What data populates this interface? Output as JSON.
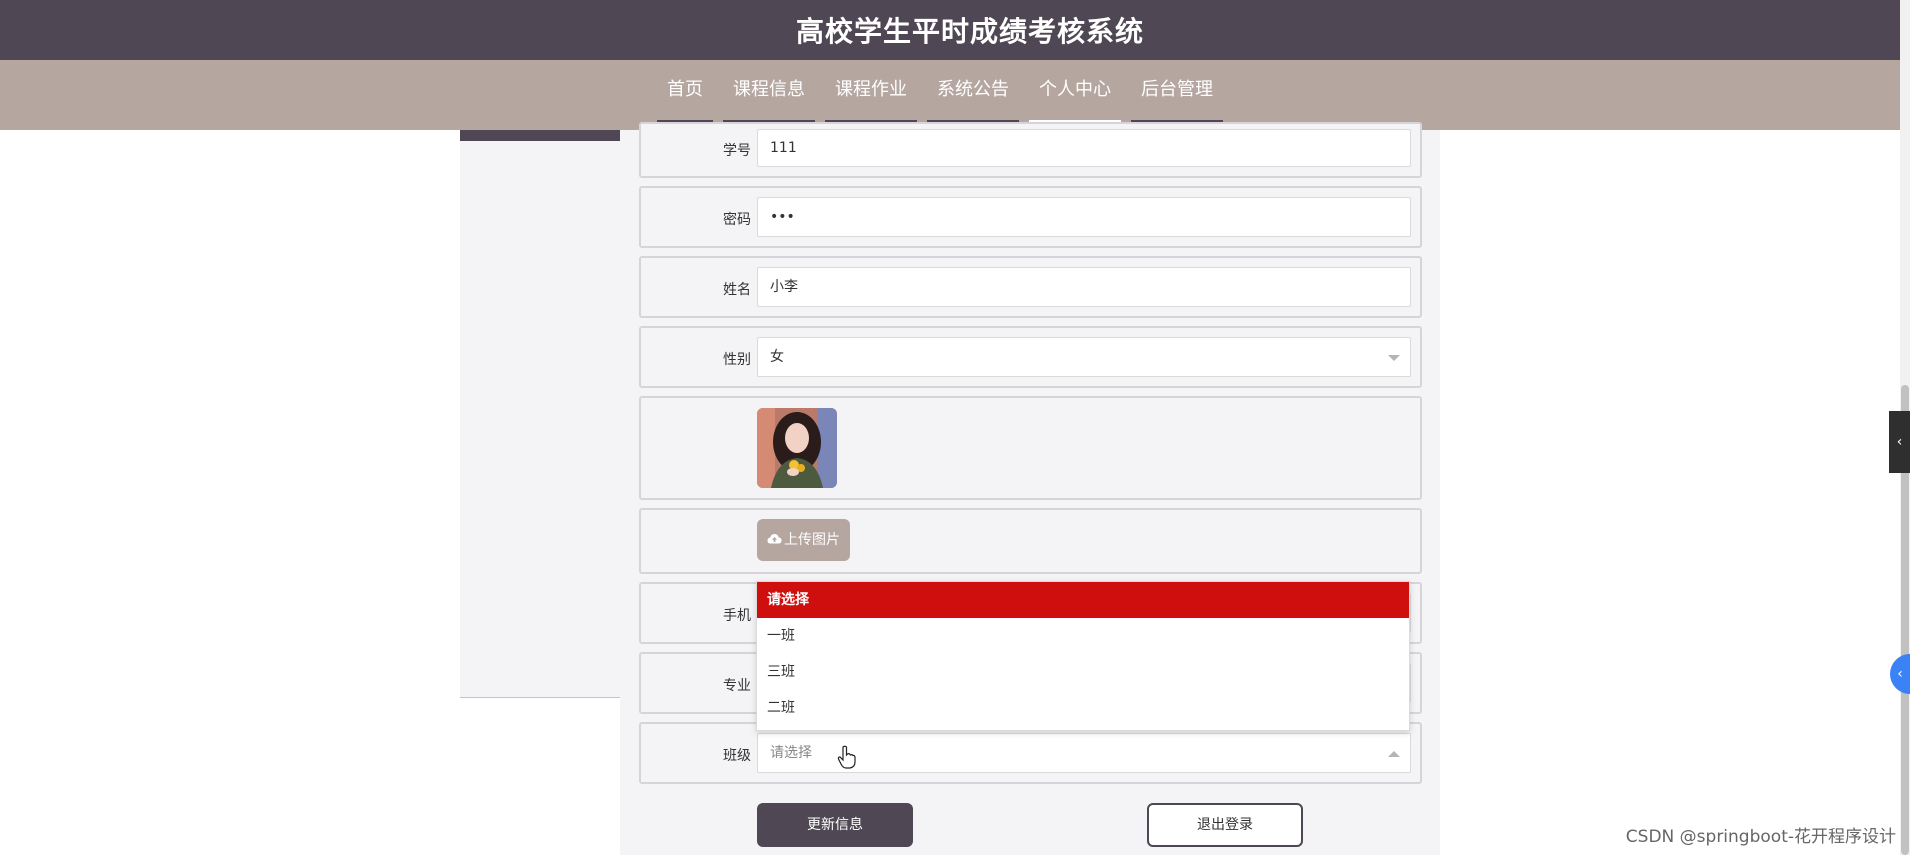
{
  "header": {
    "title": "高校学生平时成绩考核系统"
  },
  "nav": {
    "items": [
      {
        "label": "首页",
        "active": false
      },
      {
        "label": "课程信息",
        "active": false
      },
      {
        "label": "课程作业",
        "active": false
      },
      {
        "label": "系统公告",
        "active": false
      },
      {
        "label": "个人中心",
        "active": true
      },
      {
        "label": "后台管理",
        "active": false
      }
    ]
  },
  "form": {
    "student_id": {
      "label": "学号",
      "value": "111"
    },
    "password": {
      "label": "密码",
      "value": "•••"
    },
    "name": {
      "label": "姓名",
      "value": "小李"
    },
    "gender": {
      "label": "性别",
      "value": "女"
    },
    "upload": {
      "label": "上传图片"
    },
    "phone": {
      "label": "手机"
    },
    "major": {
      "label": "专业"
    },
    "class": {
      "label": "班级",
      "placeholder": "请选择"
    }
  },
  "dropdown": {
    "options": [
      "请选择",
      "一班",
      "三班",
      "二班"
    ],
    "selected_index": 0
  },
  "buttons": {
    "update": "更新信息",
    "logout": "退出登录"
  },
  "watermark": "CSDN @springboot-花开程序设计",
  "colors": {
    "header": "#4f4753",
    "nav": "#b5a6a0",
    "selected_option": "#cf0f0e"
  }
}
